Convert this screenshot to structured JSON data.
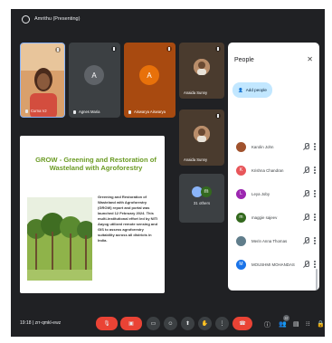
{
  "topbar": {
    "presenting_label": "Amrithu (Presenting)"
  },
  "tiles": [
    {
      "name": "Curna VJ",
      "initial": ""
    },
    {
      "name": "Agnes Maria",
      "initial": "A"
    },
    {
      "name": "Aiswarya Aiswarya",
      "initial": "A"
    },
    {
      "name": "Anaida Sunny",
      "initial": ""
    },
    {
      "name": "Anaida Sunny",
      "initial": ""
    }
  ],
  "others_tile": {
    "label": "31 others",
    "initial": "m"
  },
  "slide": {
    "title": "GROW - Greening and Restoration of Wasteland with Agroforestry",
    "body": "Greening and Restoration of Wasteland with Agroforestry (GROW) report and portal was launched 12 February 2024. This multi-institutional effort led by NITI Aayog utilized remote sensing and GIS to assess agroforestry suitability across all districts in India."
  },
  "people_panel": {
    "title": "People",
    "add_people_label": "Add people",
    "people": [
      {
        "name": "Karolin John",
        "initial": "",
        "color": "#a0522d"
      },
      {
        "name": "Krishna Chandran",
        "initial": "K",
        "color": "#e8565a"
      },
      {
        "name": "Leya Joby",
        "initial": "L",
        "color": "#9c27b0"
      },
      {
        "name": "maggie sajeev",
        "initial": "m",
        "color": "#33691e"
      },
      {
        "name": "Merin Anna Thomas",
        "initial": "",
        "color": "#607d8b"
      },
      {
        "name": "MOUSHMI MOHANDAS",
        "initial": "M",
        "color": "#1a73e8"
      }
    ]
  },
  "bottombar": {
    "time_code": "19:18  |  zrr-qmkl-ewz",
    "participant_count": "37"
  },
  "colors": {
    "accent": "#1a73e8",
    "danger": "#ea4335",
    "slide_green": "#6b9b24"
  }
}
